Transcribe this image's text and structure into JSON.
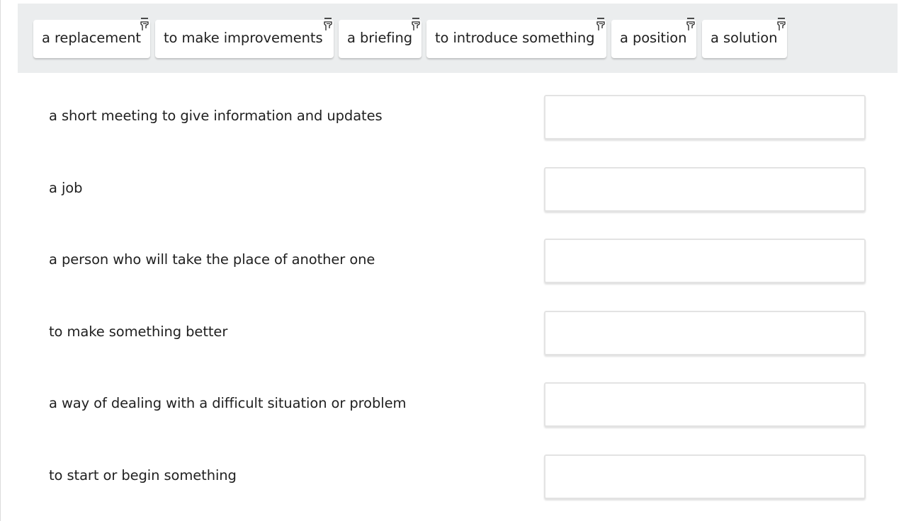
{
  "word_bank": {
    "chips": [
      {
        "label": "a replacement",
        "icon": "hand-pointer-icon"
      },
      {
        "label": "to make improvements",
        "icon": "hand-pointer-icon"
      },
      {
        "label": "a briefing",
        "icon": "hand-pointer-icon"
      },
      {
        "label": "to introduce something",
        "icon": "hand-pointer-icon"
      },
      {
        "label": "a position",
        "icon": "hand-pointer-icon"
      },
      {
        "label": "a solution",
        "icon": "hand-pointer-icon"
      }
    ]
  },
  "matching": {
    "rows": [
      {
        "definition": "a short meeting to give information and updates",
        "answer": ""
      },
      {
        "definition": "a job",
        "answer": ""
      },
      {
        "definition": "a person who will take the place of another one",
        "answer": ""
      },
      {
        "definition": "to make something better",
        "answer": ""
      },
      {
        "definition": "a way of dealing with a difficult situation or problem",
        "answer": ""
      },
      {
        "definition": "to start or begin something",
        "answer": ""
      }
    ]
  },
  "colors": {
    "bank_background": "#ebedee",
    "dropzone_border": "#e3e3e3",
    "text": "#1f1f1f"
  }
}
